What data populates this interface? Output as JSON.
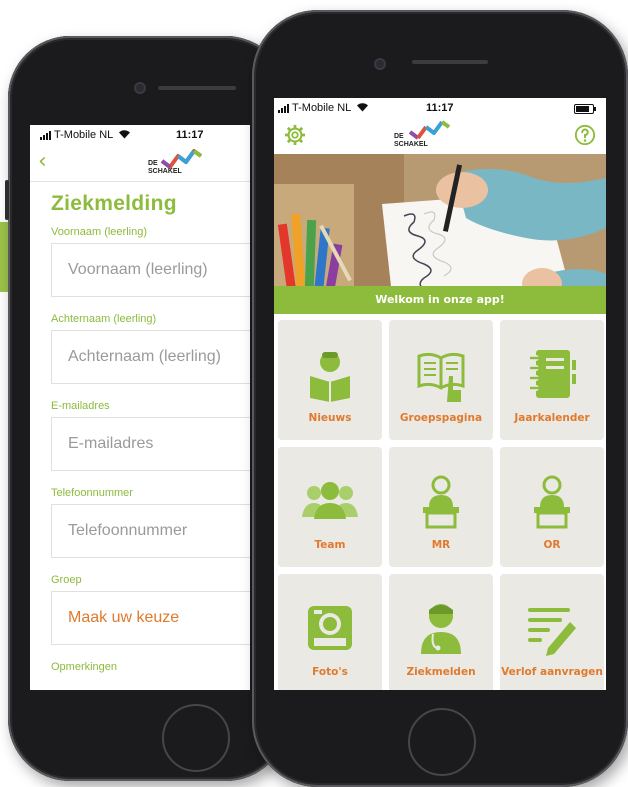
{
  "colors": {
    "green": "#8dbb3c",
    "orange": "#e07a2c",
    "tile_bg": "#ebe9e4"
  },
  "status_back": {
    "carrier": "T-Mobile NL",
    "time": "11:17"
  },
  "status_front": {
    "carrier": "T-Mobile NL",
    "time": "11:17"
  },
  "logo": {
    "line1": "DE",
    "line2": "SCHAKEL"
  },
  "form": {
    "title": "Ziekmelding",
    "fields": [
      {
        "label": "Voornaam (leerling)",
        "placeholder": "Voornaam (leerling)"
      },
      {
        "label": "Achternaam (leerling)",
        "placeholder": "Achternaam (leerling)"
      },
      {
        "label": "E-mailadres",
        "placeholder": "E-mailadres"
      },
      {
        "label": "Telefoonnummer",
        "placeholder": "Telefoonnummer"
      },
      {
        "label": "Groep",
        "value": "Maak uw keuze"
      },
      {
        "label": "Opmerkingen"
      }
    ]
  },
  "home": {
    "banner_text": "Welkom in onze app!",
    "tiles": [
      {
        "label": "Nieuws",
        "icon": "reading-person-icon"
      },
      {
        "label": "Groepspagina",
        "icon": "book-hand-icon"
      },
      {
        "label": "Jaarkalender",
        "icon": "calendar-notebook-icon"
      },
      {
        "label": "Team",
        "icon": "group-icon"
      },
      {
        "label": "MR",
        "icon": "lectern-person-icon"
      },
      {
        "label": "OR",
        "icon": "lectern-person-icon"
      },
      {
        "label": "Foto's",
        "icon": "camera-icon"
      },
      {
        "label": "Ziekmelden",
        "icon": "doctor-icon"
      },
      {
        "label": "Verlof aanvragen",
        "icon": "pencil-list-icon"
      }
    ]
  }
}
